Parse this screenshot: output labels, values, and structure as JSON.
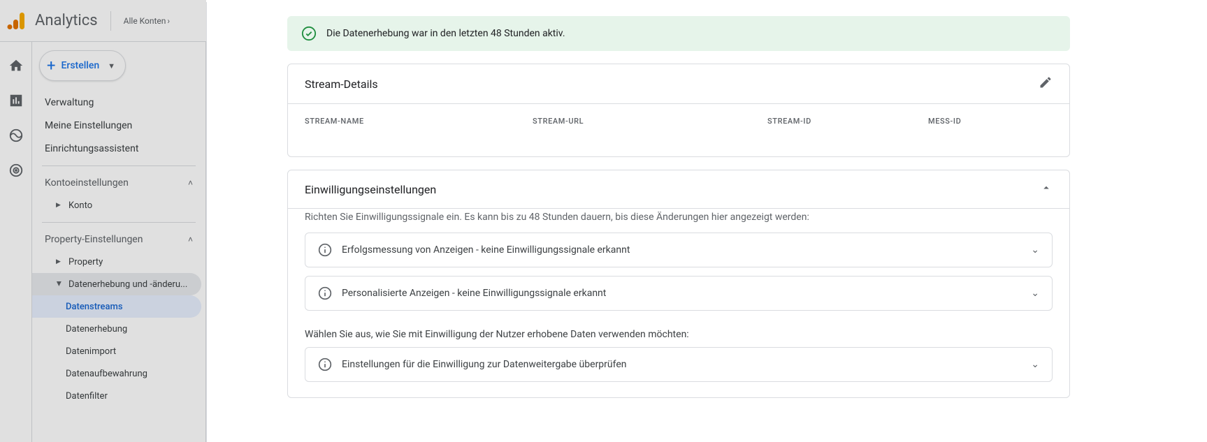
{
  "header": {
    "product": "Analytics",
    "accounts_link": "Alle Konten"
  },
  "sidebar": {
    "create": "Erstellen",
    "items_top": [
      {
        "label": "Verwaltung"
      },
      {
        "label": "Meine Einstellungen"
      },
      {
        "label": "Einrichtungsassistent"
      }
    ],
    "account_section": "Kontoeinstellungen",
    "account_item": "Konto",
    "property_section": "Property-Einstellungen",
    "property_item": "Property",
    "data_section": "Datenerhebung und -änderu...",
    "data_items": [
      {
        "label": "Datenstreams"
      },
      {
        "label": "Datenerhebung"
      },
      {
        "label": "Datenimport"
      },
      {
        "label": "Datenaufbewahrung"
      },
      {
        "label": "Datenfilter"
      }
    ]
  },
  "banner": {
    "message": "Die Datenerhebung war in den letzten 48 Stunden aktiv."
  },
  "stream_details": {
    "title": "Stream-Details",
    "cols": {
      "name": "STREAM-NAME",
      "url": "STREAM-URL",
      "id": "STREAM-ID",
      "mess": "MESS-ID"
    }
  },
  "consent": {
    "title": "Einwilligungseinstellungen",
    "subtitle": "Richten Sie Einwilligungssignale ein. Es kann bis zu 48 Stunden dauern, bis diese Änderungen hier angezeigt werden:",
    "rows": [
      {
        "text": "Erfolgsmessung von Anzeigen - keine Einwilligungssignale erkannt"
      },
      {
        "text": "Personalisierte Anzeigen - keine Einwilligungssignale erkannt"
      }
    ],
    "pick_text": "Wählen Sie aus, wie Sie mit Einwilligung der Nutzer erhobene Daten verwenden möchten:",
    "review_row": "Einstellungen für die Einwilligung zur Datenweitergabe überprüfen"
  }
}
